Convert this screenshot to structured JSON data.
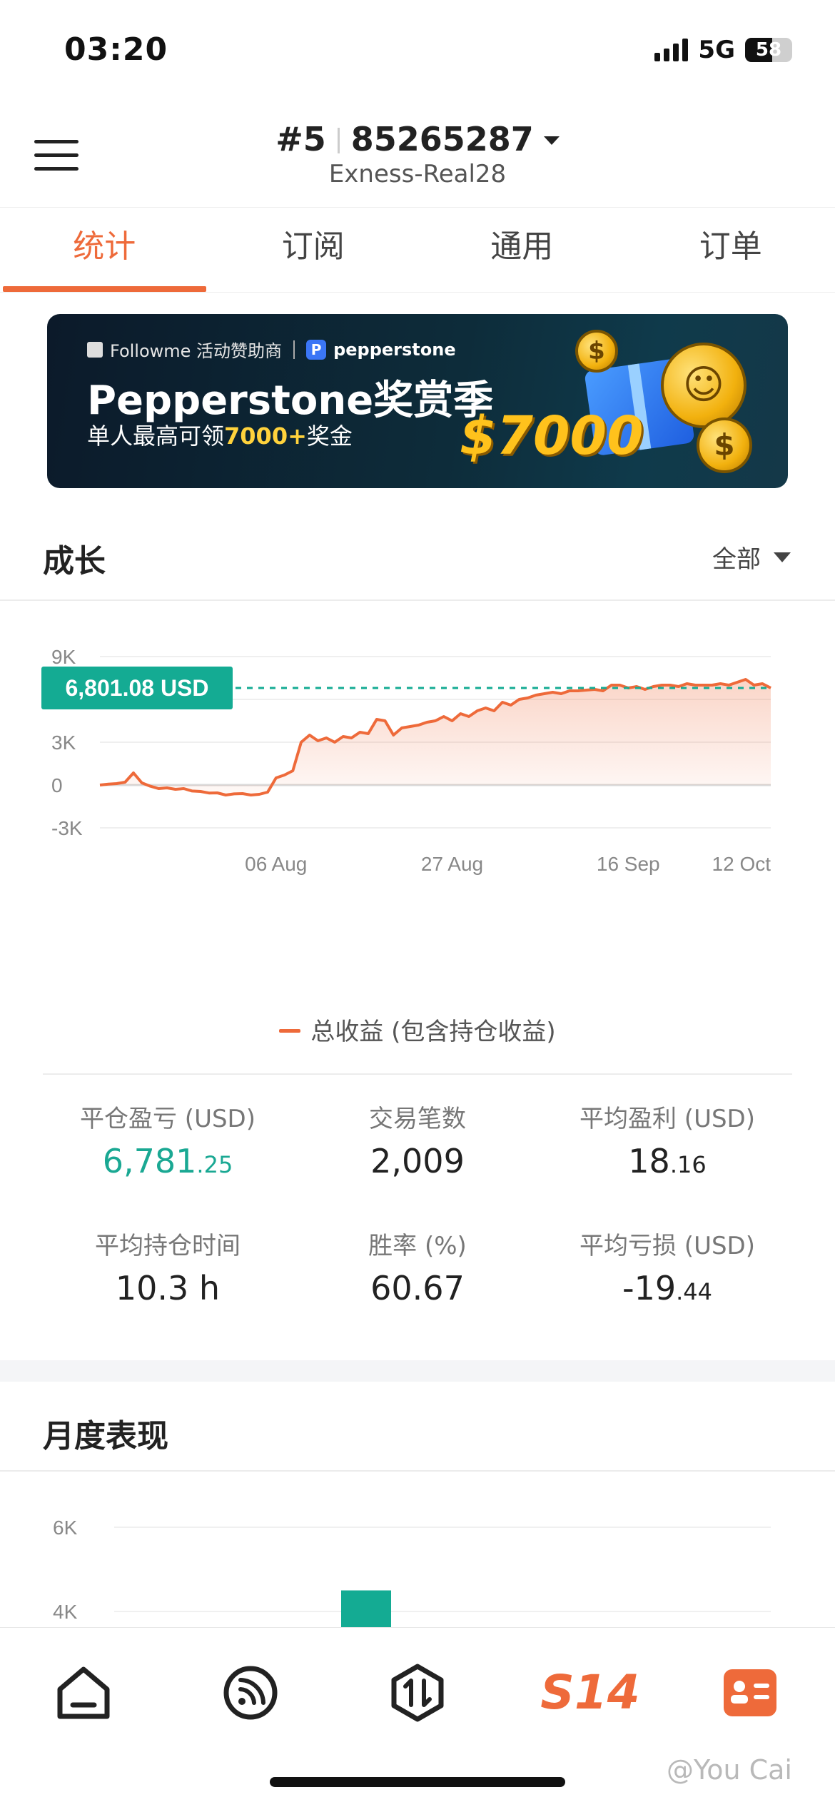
{
  "status_bar": {
    "time": "03:20",
    "network": "5G",
    "battery": "58"
  },
  "header": {
    "account_index": "#5",
    "account_number": "85265287",
    "server": "Exness-Real28"
  },
  "tabs": [
    {
      "label": "统计",
      "active": true
    },
    {
      "label": "订阅",
      "active": false
    },
    {
      "label": "通用",
      "active": false
    },
    {
      "label": "订单",
      "active": false
    }
  ],
  "banner": {
    "sponsor_text": "Followme 活动赞助商",
    "partner": "pepperstone",
    "title": "Pepperstone奖赏季",
    "subtitle_prefix": "单人最高可领",
    "subtitle_highlight": "7000+",
    "subtitle_suffix": "奖金",
    "amount": "$7000"
  },
  "growth": {
    "title": "成长",
    "filter": "全部",
    "current_value_label": "6,801.08 USD",
    "legend": "总收益 (包含持仓收益)"
  },
  "chart_data": {
    "type": "area",
    "title": "",
    "xlabel": "",
    "ylabel": "",
    "y_ticks": [
      "9K",
      "6K",
      "3K",
      "0",
      "-3K"
    ],
    "y_tick_values": [
      9000,
      6000,
      3000,
      0,
      -3000
    ],
    "ylim": [
      -3000,
      9000
    ],
    "x_ticks": [
      "06 Aug",
      "27 Aug",
      "16 Sep",
      "12 Oct"
    ],
    "x_tick_index": [
      21,
      42,
      63,
      80
    ],
    "reference_value": 6801.08,
    "series": [
      {
        "name": "总收益 (包含持仓收益)",
        "color": "#ee6a3a",
        "values": [
          0,
          60,
          100,
          200,
          850,
          150,
          -80,
          -250,
          -200,
          -300,
          -250,
          -420,
          -450,
          -560,
          -550,
          -700,
          -620,
          -600,
          -700,
          -650,
          -500,
          500,
          700,
          1000,
          3000,
          3500,
          3100,
          3300,
          3000,
          3400,
          3300,
          3700,
          3600,
          4600,
          4500,
          3500,
          4000,
          4100,
          4200,
          4400,
          4500,
          4800,
          4500,
          5000,
          4800,
          5200,
          5400,
          5200,
          5800,
          5600,
          6000,
          6100,
          6300,
          6400,
          6500,
          6400,
          6600,
          6600,
          6650,
          6700,
          6600,
          7000,
          7000,
          6800,
          6900,
          6700,
          6900,
          7000,
          7000,
          6900,
          7100,
          7000,
          7000,
          7000,
          7100,
          7000,
          7200,
          7400,
          7000,
          7100,
          6801.08
        ]
      }
    ],
    "grid": true
  },
  "stats": [
    {
      "label": "平仓盈亏 (USD)",
      "int": "6,781",
      "frac": ".25",
      "highlight": true
    },
    {
      "label": "交易笔数",
      "int": "2,009",
      "frac": "",
      "highlight": false
    },
    {
      "label": "平均盈利 (USD)",
      "int": "18",
      "frac": ".16",
      "highlight": false
    },
    {
      "label": "平均持仓时间",
      "int": "10.3 h",
      "frac": "",
      "highlight": false
    },
    {
      "label": "胜率 (%)",
      "int": "60.67",
      "frac": "",
      "highlight": false
    },
    {
      "label": "平均亏损 (USD)",
      "int": "-19",
      "frac": ".44",
      "highlight": false
    }
  ],
  "monthly": {
    "title": "月度表现",
    "y_ticks": [
      "6K",
      "4K"
    ],
    "bar_color": "#14ab93",
    "visible_bar_value": 4500
  },
  "nav": {
    "brand": "S14",
    "active_color": "#ee6a3a",
    "items": [
      "home-icon",
      "feed-icon",
      "trade-icon",
      "s14-logo",
      "profile-card-icon"
    ]
  },
  "watermark": "@You Cai",
  "colors": {
    "accent": "#ee6a3a",
    "green": "#14ab93"
  }
}
